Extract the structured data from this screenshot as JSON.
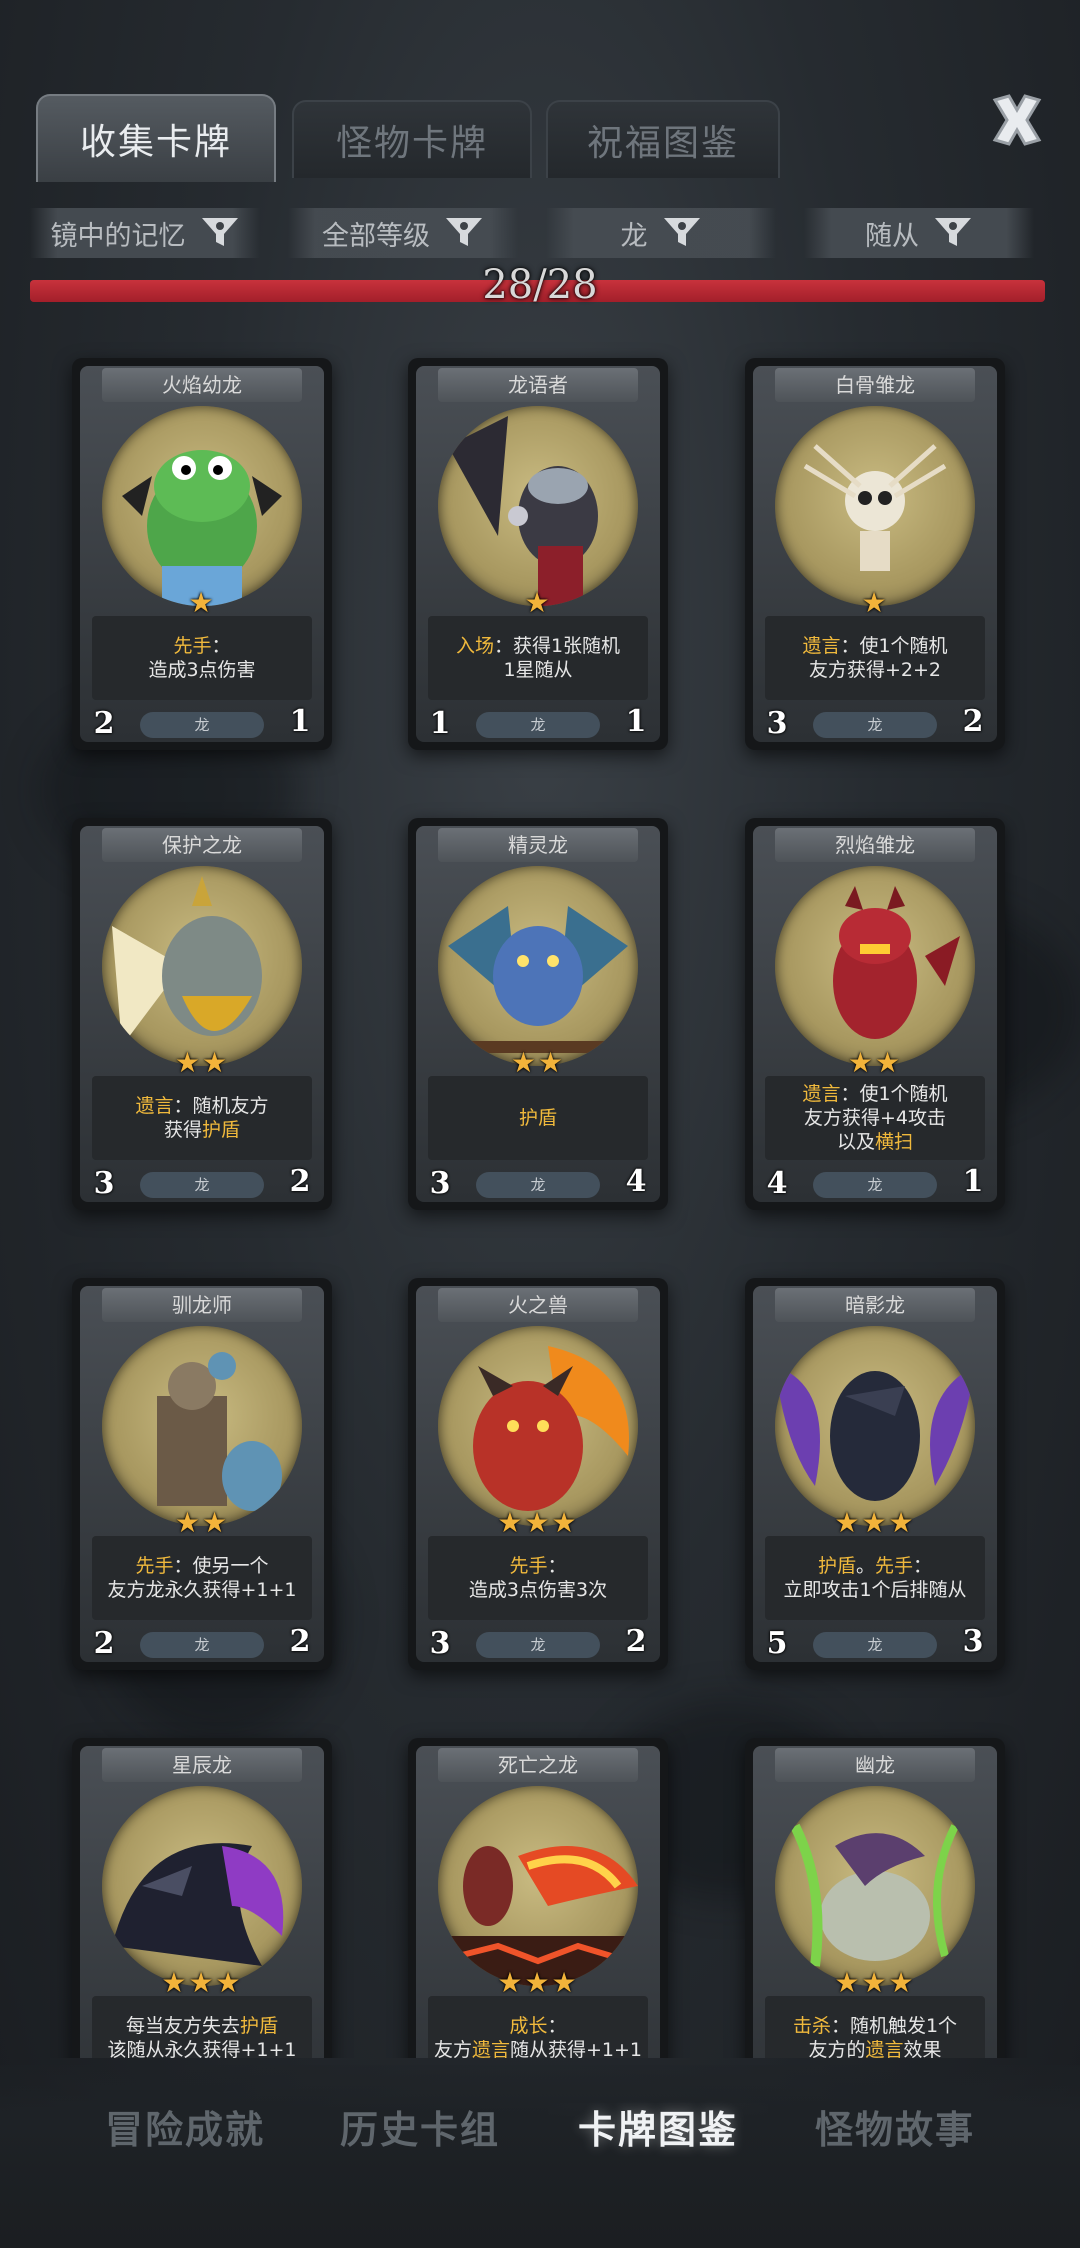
{
  "tabs": [
    {
      "label": "收集卡牌",
      "active": true
    },
    {
      "label": "怪物卡牌",
      "active": false
    },
    {
      "label": "祝福图鉴",
      "active": false
    }
  ],
  "filters": [
    {
      "label": "镜中的记忆"
    },
    {
      "label": "全部等级"
    },
    {
      "label": "龙"
    },
    {
      "label": "随从"
    }
  ],
  "progress": {
    "text": "28/28",
    "fraction": 1.0
  },
  "cards": [
    {
      "name": "火焰幼龙",
      "stars": "★",
      "cost": "2",
      "health": "1",
      "race": "龙",
      "desc": [
        [
          {
            "t": "先手",
            "k": true
          },
          {
            "t": "：",
            "k": false
          }
        ],
        [
          {
            "t": "造成3点伤害",
            "k": false
          }
        ]
      ],
      "portrait": "green-dragon"
    },
    {
      "name": "龙语者",
      "stars": "★",
      "cost": "1",
      "health": "1",
      "race": "龙",
      "desc": [
        [
          {
            "t": "入场",
            "k": true
          },
          {
            "t": "：获得1张随机",
            "k": false
          }
        ],
        [
          {
            "t": "1星随从",
            "k": false
          }
        ]
      ],
      "portrait": "dragon-speaker"
    },
    {
      "name": "白骨雏龙",
      "stars": "★",
      "cost": "3",
      "health": "2",
      "race": "龙",
      "desc": [
        [
          {
            "t": "遗言",
            "k": true
          },
          {
            "t": "：使1个随机",
            "k": false
          }
        ],
        [
          {
            "t": "友方获得+2+2",
            "k": false
          }
        ]
      ],
      "portrait": "bone-dragon"
    },
    {
      "name": "保护之龙",
      "stars": "★★",
      "cost": "3",
      "health": "2",
      "race": "龙",
      "desc": [
        [
          {
            "t": "遗言",
            "k": true
          },
          {
            "t": "：随机友方",
            "k": false
          }
        ],
        [
          {
            "t": "获得",
            "k": false
          },
          {
            "t": "护盾",
            "k": true
          }
        ]
      ],
      "portrait": "guardian-dragon"
    },
    {
      "name": "精灵龙",
      "stars": "★★",
      "cost": "3",
      "health": "4",
      "race": "龙",
      "desc": [
        [
          {
            "t": "护盾",
            "k": true
          }
        ]
      ],
      "portrait": "fairy-dragon"
    },
    {
      "name": "烈焰雏龙",
      "stars": "★★",
      "cost": "4",
      "health": "1",
      "race": "龙",
      "desc": [
        [
          {
            "t": "遗言",
            "k": true
          },
          {
            "t": "：使1个随机",
            "k": false
          }
        ],
        [
          {
            "t": "友方获得+4攻击",
            "k": false
          }
        ],
        [
          {
            "t": "以及",
            "k": false
          },
          {
            "t": "横扫",
            "k": true
          }
        ]
      ],
      "portrait": "flame-dragon"
    },
    {
      "name": "驯龙师",
      "stars": "★★",
      "cost": "2",
      "health": "2",
      "race": "龙",
      "desc": [
        [
          {
            "t": "先手",
            "k": true
          },
          {
            "t": "：使另一个",
            "k": false
          }
        ],
        [
          {
            "t": "友方龙永久获得+1+1",
            "k": false
          }
        ]
      ],
      "portrait": "dragon-tamer"
    },
    {
      "name": "火之兽",
      "stars": "★★★",
      "cost": "3",
      "health": "2",
      "race": "龙",
      "desc": [
        [
          {
            "t": "先手",
            "k": true
          },
          {
            "t": "：",
            "k": false
          }
        ],
        [
          {
            "t": "造成3点伤害3次",
            "k": false
          }
        ]
      ],
      "portrait": "fire-beast"
    },
    {
      "name": "暗影龙",
      "stars": "★★★",
      "cost": "5",
      "health": "3",
      "race": "龙",
      "desc": [
        [
          {
            "t": "护盾",
            "k": true
          },
          {
            "t": "。",
            "k": false
          },
          {
            "t": "先手",
            "k": true
          },
          {
            "t": "：",
            "k": false
          }
        ],
        [
          {
            "t": "立即攻击1个后排随从",
            "k": false
          }
        ]
      ],
      "portrait": "shadow-dragon"
    },
    {
      "name": "星辰龙",
      "stars": "★★★",
      "cost": "",
      "health": "",
      "race": "",
      "desc": [
        [
          {
            "t": "每当友方失去",
            "k": false
          },
          {
            "t": "护盾",
            "k": true
          }
        ],
        [
          {
            "t": "该随从永久获得+1+1",
            "k": false
          }
        ]
      ],
      "portrait": "star-dragon"
    },
    {
      "name": "死亡之龙",
      "stars": "★★★",
      "cost": "",
      "health": "",
      "race": "",
      "desc": [
        [
          {
            "t": "成长",
            "k": true
          },
          {
            "t": "：",
            "k": false
          }
        ],
        [
          {
            "t": "友方",
            "k": false
          },
          {
            "t": "遗言",
            "k": true
          },
          {
            "t": "随从获得+1+1",
            "k": false
          }
        ]
      ],
      "portrait": "death-dragon"
    },
    {
      "name": "幽龙",
      "stars": "★★★",
      "cost": "",
      "health": "",
      "race": "",
      "desc": [
        [
          {
            "t": "击杀",
            "k": true
          },
          {
            "t": "：随机触发1个",
            "k": false
          }
        ],
        [
          {
            "t": "友方的",
            "k": false
          },
          {
            "t": "遗言",
            "k": true
          },
          {
            "t": "效果",
            "k": false
          }
        ]
      ],
      "portrait": "ghost-dragon"
    }
  ],
  "bottom_nav": [
    {
      "label": "冒险成就",
      "active": false
    },
    {
      "label": "历史卡组",
      "active": false
    },
    {
      "label": "卡牌图鉴",
      "active": true
    },
    {
      "label": "怪物故事",
      "active": false
    }
  ],
  "colors": {
    "keyword": "#f0b93c",
    "progress_fill": "#c8323c",
    "cost_gem": "#2c86c7",
    "health_gem": "#b3202c",
    "star": "#f2b33a"
  }
}
